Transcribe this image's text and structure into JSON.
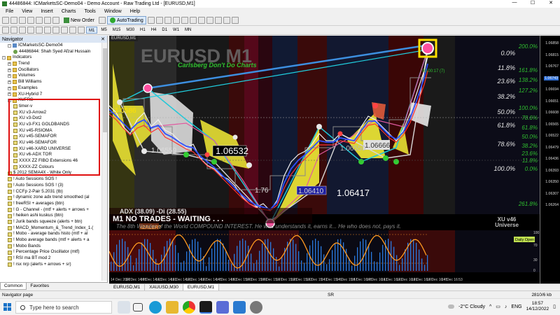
{
  "window": {
    "title": "44486844: ICMarketsSC-Demo04 - Demo Account - Raw Trading Ltd - [EURUSD,M1]",
    "min_label": "—",
    "max_label": "☐",
    "close_label": "✕"
  },
  "menu": [
    "File",
    "View",
    "Insert",
    "Charts",
    "Tools",
    "Window",
    "Help"
  ],
  "toolbar": {
    "new_order": "New Order",
    "autotrading": "AutoTrading"
  },
  "timeframes": [
    "M1",
    "M5",
    "M15",
    "M30",
    "H1",
    "H4",
    "D1",
    "W1",
    "MN"
  ],
  "navigator": {
    "title": "Navigator",
    "tree": [
      {
        "label": "ICMarketsSC-Demo04",
        "type": "srv",
        "lvl": 1,
        "exp": "-"
      },
      {
        "label": "44486844: Shah Syed Afzal Hussain",
        "type": "usr",
        "lvl": 2,
        "exp": ""
      },
      {
        "label": "Indicators",
        "type": "fold",
        "lvl": 0,
        "exp": "-"
      },
      {
        "label": "Trend",
        "type": "fold",
        "lvl": 1,
        "exp": "+"
      },
      {
        "label": "Oscillators",
        "type": "fold",
        "lvl": 1,
        "exp": "+"
      },
      {
        "label": "Volumes",
        "type": "fold",
        "lvl": 1,
        "exp": "+"
      },
      {
        "label": "Bill Williams",
        "type": "fold",
        "lvl": 1,
        "exp": "+"
      },
      {
        "label": "Examples",
        "type": "fold",
        "lvl": 1,
        "exp": "+"
      },
      {
        "label": "XU-Hybrid 7",
        "type": "fold",
        "lvl": 1,
        "exp": "+"
      },
      {
        "label": "XUFRS",
        "type": "fold",
        "lvl": 1,
        "exp": "-"
      },
      {
        "label": "timer-v",
        "type": "ind",
        "lvl": 2,
        "exp": ""
      },
      {
        "label": "XU v3-Arrow2",
        "type": "ind",
        "lvl": 2,
        "exp": ""
      },
      {
        "label": "XU v3-Dot2",
        "type": "ind",
        "lvl": 2,
        "exp": ""
      },
      {
        "label": "XU v3-FX1 GOLDBANDS",
        "type": "ind",
        "lvl": 2,
        "exp": ""
      },
      {
        "label": "XU v45-RSIOMA",
        "type": "ind",
        "lvl": 2,
        "exp": ""
      },
      {
        "label": "XU v45-SEMAFOR",
        "type": "ind",
        "lvl": 2,
        "exp": ""
      },
      {
        "label": "XU v46-SEMAFOR",
        "type": "ind",
        "lvl": 2,
        "exp": ""
      },
      {
        "label": "XU v46-XARD UNIVERSE",
        "type": "ind",
        "lvl": 2,
        "exp": ""
      },
      {
        "label": "XU v6-ADX TOR",
        "type": "ind",
        "lvl": 2,
        "exp": ""
      },
      {
        "label": "XXXX ZZ FIBO Extensions 46",
        "type": "ind",
        "lvl": 2,
        "exp": ""
      },
      {
        "label": "XXXX-ZZ Colours",
        "type": "ind",
        "lvl": 2,
        "exp": ""
      },
      {
        "label": "$ 2012 SEMA4X - White Only",
        "type": "ind",
        "lvl": 1,
        "exp": ""
      },
      {
        "label": "! Auto Sessions SOS !",
        "type": "ind",
        "lvl": 1,
        "exp": ""
      },
      {
        "label": "! Auto Sessions SOS ! (3)",
        "type": "ind",
        "lvl": 1,
        "exp": ""
      },
      {
        "label": "! CCFp 2-Pair 5.2031 (tb)",
        "type": "ind",
        "lvl": 1,
        "exp": ""
      },
      {
        "label": "! dynamic zone adx trend smoothed (al",
        "type": "ind",
        "lvl": 1,
        "exp": ""
      },
      {
        "label": "! freeRSI + averages (btn)",
        "type": "ind",
        "lvl": 1,
        "exp": ""
      },
      {
        "label": "! G - Channel - (mtf + alerts + arrows +",
        "type": "ind",
        "lvl": 1,
        "exp": ""
      },
      {
        "label": "! heiken ashi kuskus (btn)",
        "type": "ind",
        "lvl": 1,
        "exp": ""
      },
      {
        "label": "! Jurik bands squeeze (alerts + btn)",
        "type": "ind",
        "lvl": 1,
        "exp": ""
      },
      {
        "label": "! MACD_Momentum_&_Trend_Index_1.(",
        "type": "ind",
        "lvl": 1,
        "exp": ""
      },
      {
        "label": "! Mobo - average bands histo (mtf + al",
        "type": "ind",
        "lvl": 1,
        "exp": ""
      },
      {
        "label": "! Mobo average bands (mtf + alerts + a",
        "type": "ind",
        "lvl": 1,
        "exp": ""
      },
      {
        "label": "! Mobo Bands",
        "type": "ind",
        "lvl": 1,
        "exp": ""
      },
      {
        "label": "! Percentage Price Oscillator (mtf)",
        "type": "ind",
        "lvl": 1,
        "exp": ""
      },
      {
        "label": "! RSI ma BT mod 2",
        "type": "ind",
        "lvl": 1,
        "exp": ""
      },
      {
        "label": "! rsx nrp (alerts + arrows + sr)",
        "type": "ind",
        "lvl": 1,
        "exp": ""
      }
    ],
    "tabs": [
      "Common",
      "Favorites"
    ]
  },
  "chart": {
    "tab_label": "EURUSD,M1",
    "big_title": "EURUSD M1",
    "subtitle": "Carlsberg Don't Do Charts",
    "adx_text": "ADX (38.09)  -Di (28.55)",
    "status_text": "M1  NO TRADES - WAITING . . .",
    "zalert": "IZALERT",
    "quote": "The 8th Wonder of the World COMPOUND INTEREST. He who understands it, earns it... He who does not, pays it.",
    "universe_1": "XU v46",
    "universe_2": "Universe",
    "timer": "00:00:17 (7)",
    "labels": {
      "p1": "1.06532",
      "p2": "1.06417",
      "p3": "1.06410",
      "p4": "1.06559",
      "p5": "1.06666",
      "p6": "1.0586",
      "p7": "1.76",
      "p8": "1.06550"
    },
    "fib_left": [
      "0.0%",
      "11.8%",
      "23.6%",
      "38.2%",
      "50.0%",
      "61.8%",
      "78.6%",
      "100.0%"
    ],
    "fib_right": [
      "200.0%",
      "161.8%",
      "138.2%",
      "127.2%",
      "100.0%",
      "78.6%",
      "61.8%",
      "50.0%",
      "38.2%",
      "23.6%",
      "11.8%",
      "0.0%",
      "261.8%"
    ],
    "time_labels": [
      "14 Dec 2022",
      "14 Dec 14:05",
      "14 Dec 14:13",
      "14 Dec 14:21",
      "14 Dec 14:29",
      "14 Dec 14:37",
      "14 Dec 14:45",
      "14 Dec 14:53",
      "14 Dec 15:01",
      "14 Dec 15:09",
      "14 Dec 15:17",
      "14 Dec 15:25",
      "14 Dec 15:33",
      "14 Dec 15:41",
      "14 Dec 15:49",
      "14 Dec 15:57",
      "14 Dec 16:05",
      "14 Dec 16:13",
      "14 Dec 16:21",
      "14 Dec 16:29",
      "14 Dec 16:37",
      "14 Dec 16:45",
      "14 Dec 16:53"
    ],
    "osc_label": "Daily Open",
    "osc_levels": [
      "100",
      "70",
      "30",
      "0"
    ]
  },
  "price_axis": [
    "1.06858",
    "1.06815",
    "1.06767",
    "1.06743",
    "1.06694",
    "1.06651",
    "1.06608",
    "1.06565",
    "1.06522",
    "1.06479",
    "1.06436",
    "1.06393",
    "1.06350",
    "1.06307",
    "1.06264"
  ],
  "price_axis_highlight": "1.06743",
  "chart_tabs": [
    "EURUSD,M1",
    "XAUUSD,M30",
    "EURUSD,M1"
  ],
  "status": {
    "left": "Navigator page",
    "mid": "SR",
    "right": "2810/6 kb"
  },
  "taskbar": {
    "search_placeholder": "Type here to search",
    "weather": "-2°C  Cloudy",
    "time": "18:57",
    "date": "14/12/2022"
  }
}
